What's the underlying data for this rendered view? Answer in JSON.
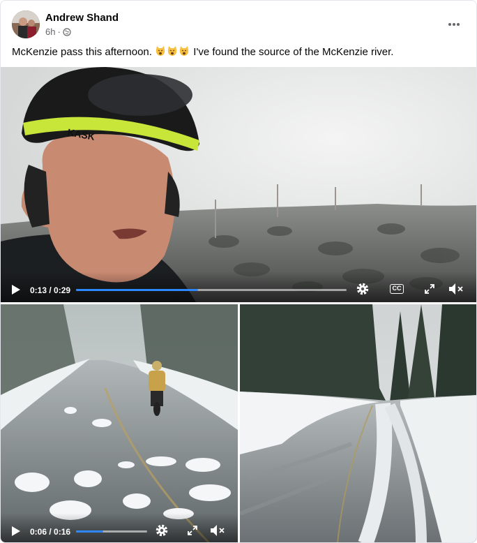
{
  "post": {
    "author": "Andrew Shand",
    "time": "6h",
    "separator": "·",
    "audience_icon": "globe-icon",
    "more_icon": "more-dots-icon",
    "caption_before": "McKenzie pass this afternoon.",
    "caption_emojis": [
      "weary-cat-face-emoji",
      "weary-cat-face-emoji",
      "weary-cat-face-emoji"
    ],
    "caption_after": "I've found the source of the McKenzie river."
  },
  "videos": [
    {
      "time_label": "0:13 / 0:29",
      "progress": 0.45,
      "controls": [
        "play-icon",
        "settings-icon",
        "captions-icon",
        "fullscreen-icon",
        "mute-icon"
      ],
      "cc_label": "CC"
    },
    {
      "time_label": "0:06 / 0:16",
      "progress": 0.38,
      "controls": [
        "play-icon",
        "settings-icon",
        "fullscreen-icon",
        "mute-icon"
      ]
    }
  ],
  "colors": {
    "progress": "#2d88ff",
    "secondary_text": "#65676b",
    "helmet_accent": "#c8e63a"
  },
  "images": [
    "cyclist selfie wearing a helmet in fog beside a field of grey boulders",
    "cyclist riding through meltwater on a snowy road",
    "snow-covered road with tire tracks between pine trees"
  ]
}
